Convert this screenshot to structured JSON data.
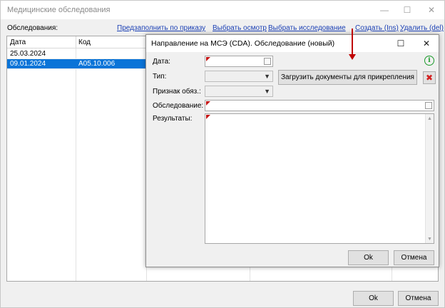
{
  "window": {
    "title": "Медицинские обследования",
    "minimize_glyph": "—",
    "maximize_glyph": "☐",
    "close_glyph": "✕"
  },
  "toolbar": {
    "label": "Обследования:",
    "links": [
      {
        "label": "Предзаполнить по приказу"
      },
      {
        "label": "Выбрать осмотр"
      },
      {
        "label": "Выбрать исследование"
      },
      {
        "label": "Создать (Ins)"
      },
      {
        "label": "Удалить (del)"
      }
    ]
  },
  "grid": {
    "columns": [
      "Дата",
      "Код"
    ],
    "rows": [
      {
        "date": "25.03.2024",
        "code": "",
        "selected": false
      },
      {
        "date": "09.01.2024",
        "code": "A05.10.006",
        "selected": true
      }
    ]
  },
  "footer": {
    "ok_label": "Ok",
    "cancel_label": "Отмена"
  },
  "dialog": {
    "title": "Направление на МСЭ (CDA). Обследование (новый)",
    "maximize_glyph": "☐",
    "close_glyph": "✕",
    "fields": {
      "date_label": "Дата:",
      "type_label": "Тип:",
      "flag_label": "Признак обяз.:",
      "exam_label": "Обследование:",
      "results_label": "Результаты:"
    },
    "upload_button_label": "Загрузить документы для прикрепления",
    "ok_label": "Ok",
    "cancel_label": "Отмена",
    "icons": {
      "info": "info-icon",
      "delete": "delete-attachment-icon"
    }
  },
  "colors": {
    "selection": "#0a74d8",
    "link": "#1a3fb4",
    "required_marker": "#c41414",
    "annotation_arrow": "#c00000",
    "info_icon": "#1a9a2a"
  }
}
